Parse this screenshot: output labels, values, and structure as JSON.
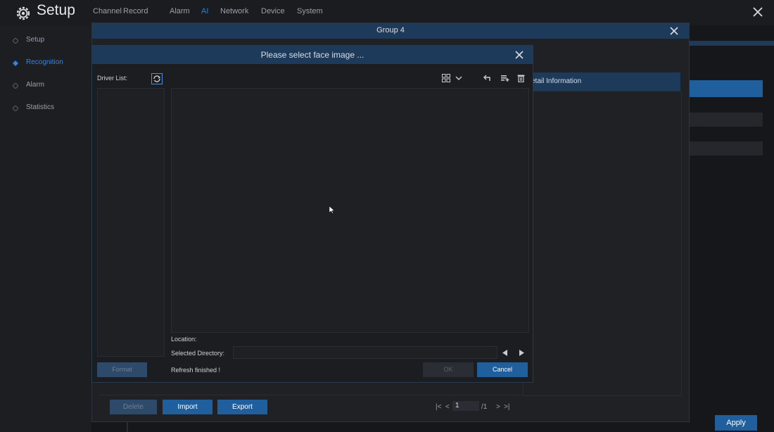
{
  "app": {
    "title": "Setup",
    "icon": "gear-icon"
  },
  "topnav": [
    {
      "label": "Channel",
      "active": false
    },
    {
      "label": "Record",
      "active": false
    },
    {
      "label": "Alarm",
      "active": false
    },
    {
      "label": "AI",
      "active": true
    },
    {
      "label": "Network",
      "active": false
    },
    {
      "label": "Device",
      "active": false
    },
    {
      "label": "System",
      "active": false
    }
  ],
  "sidebar": {
    "items": [
      {
        "label": "Setup",
        "active": false
      },
      {
        "label": "Recognition",
        "active": true
      },
      {
        "label": "Alarm",
        "active": false
      },
      {
        "label": "Statistics",
        "active": false
      }
    ]
  },
  "group_dialog": {
    "title": "Group 4",
    "detail_header": "etail Information",
    "buttons": {
      "delete": "Delete",
      "import": "Import",
      "export": "Export"
    },
    "pagination": {
      "first": "|<",
      "prev": "<",
      "current": "1",
      "total": "/1",
      "next": ">",
      "last": ">|"
    }
  },
  "face_dialog": {
    "title": "Please select face image ...",
    "driver_list_label": "Driver List:",
    "location_label": "Location:",
    "selected_directory_label": "Selected Directory:",
    "selected_directory_value": "",
    "status": "Refresh finished !",
    "buttons": {
      "format": "Format",
      "ok": "OK",
      "cancel": "Cancel"
    }
  },
  "apply_label": "Apply",
  "colors": {
    "accent": "#1f5f9e",
    "title_bar": "#1e3a5a",
    "active_text": "#2e86e8"
  }
}
